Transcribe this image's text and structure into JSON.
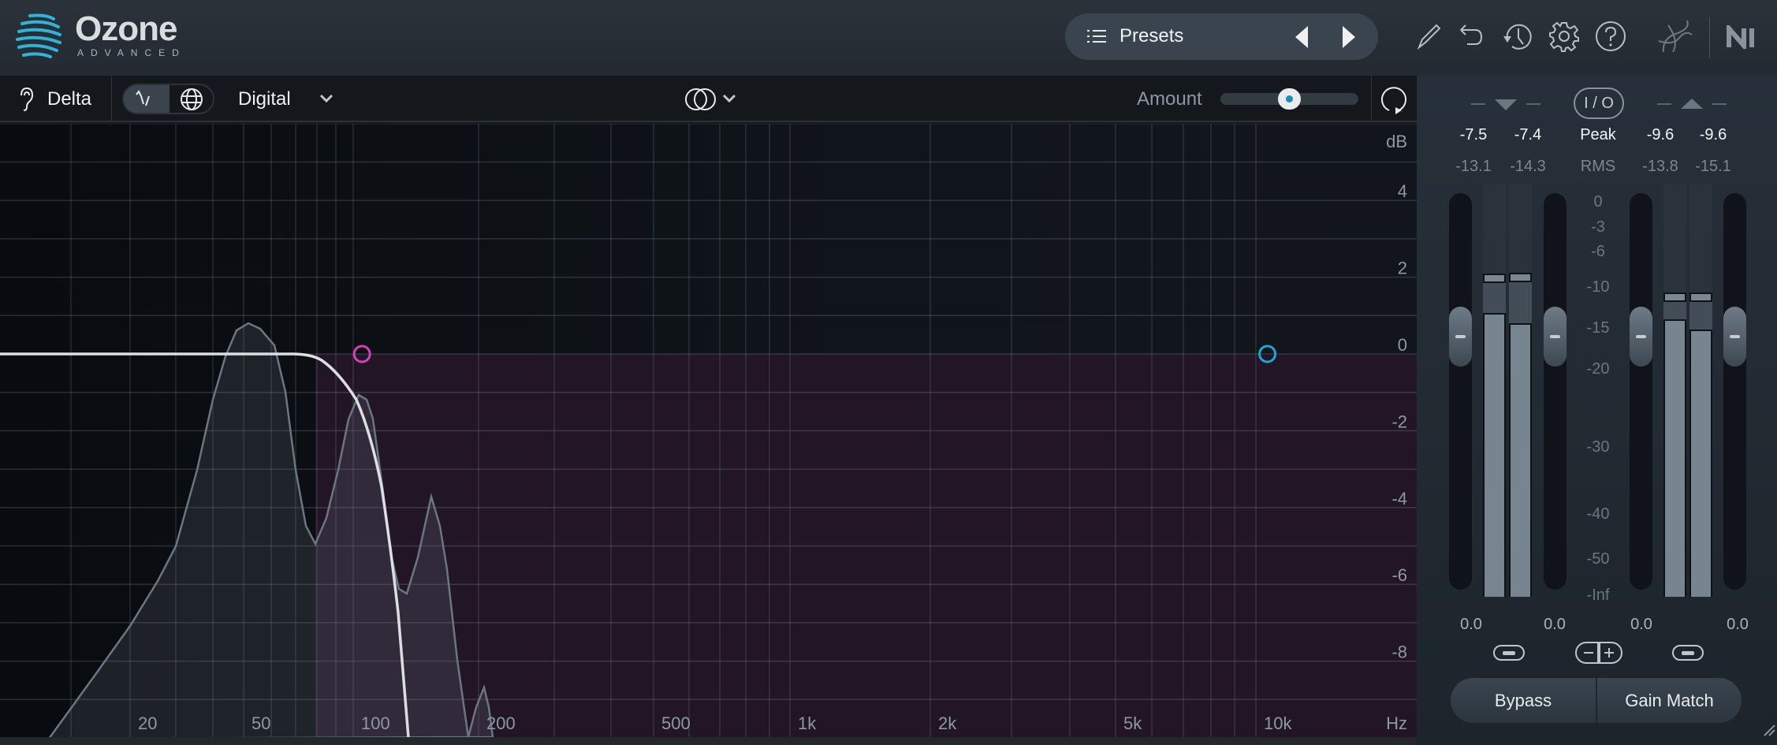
{
  "header": {
    "logo": {
      "name": "Ozone",
      "subtitle": "ADVANCED"
    },
    "presets": {
      "label": "Presets",
      "icon": "list-icon",
      "prev_icon": "triangle-left-icon",
      "next_icon": "triangle-right-icon"
    },
    "icons": [
      "pencil-icon",
      "undo-icon",
      "history-icon",
      "gear-icon",
      "help-icon",
      "ozone-assistant-icon",
      "ni-logo-icon"
    ]
  },
  "toolbar": {
    "delta_label": "Delta",
    "mode_label": "Digital",
    "amount_label": "Amount",
    "amount_value": 0.5,
    "icons": [
      "ear-icon",
      "filter-shape-icon",
      "globe-icon",
      "chevron-down-icon",
      "stereo-icon",
      "reset-icon"
    ]
  },
  "graph": {
    "db_unit": "dB",
    "db_labels": [
      "4",
      "2",
      "0",
      "-2",
      "-4",
      "-6",
      "-8"
    ],
    "hz_unit": "Hz",
    "freq_labels": [
      "20",
      "50",
      "100",
      "200",
      "500",
      "1k",
      "2k",
      "5k",
      "10k"
    ],
    "nodes": [
      {
        "color": "#d63fb5",
        "gain_db": 0,
        "freq_hz": 105
      },
      {
        "color": "#1ea7d6",
        "gain_db": 0,
        "freq_hz": 10500
      }
    ],
    "filter_region_color": "#221626"
  },
  "meters": {
    "peak_label": "Peak",
    "rms_label": "RMS",
    "io_label": "I / O",
    "input": {
      "peak": [
        "-7.5",
        "-7.4"
      ],
      "rms": [
        "-13.1",
        "-14.3"
      ],
      "gain": [
        "0.0",
        "0.0"
      ]
    },
    "output": {
      "peak": [
        "-9.6",
        "-9.6"
      ],
      "rms": [
        "-13.8",
        "-15.1"
      ],
      "gain": [
        "0.0",
        "0.0"
      ]
    },
    "scale": [
      "0",
      "-3",
      "-6",
      "-10",
      "-15",
      "-20",
      "-30",
      "-40",
      "-50",
      "-Inf"
    ]
  },
  "footer": {
    "bypass_label": "Bypass",
    "gain_match_label": "Gain Match"
  }
}
